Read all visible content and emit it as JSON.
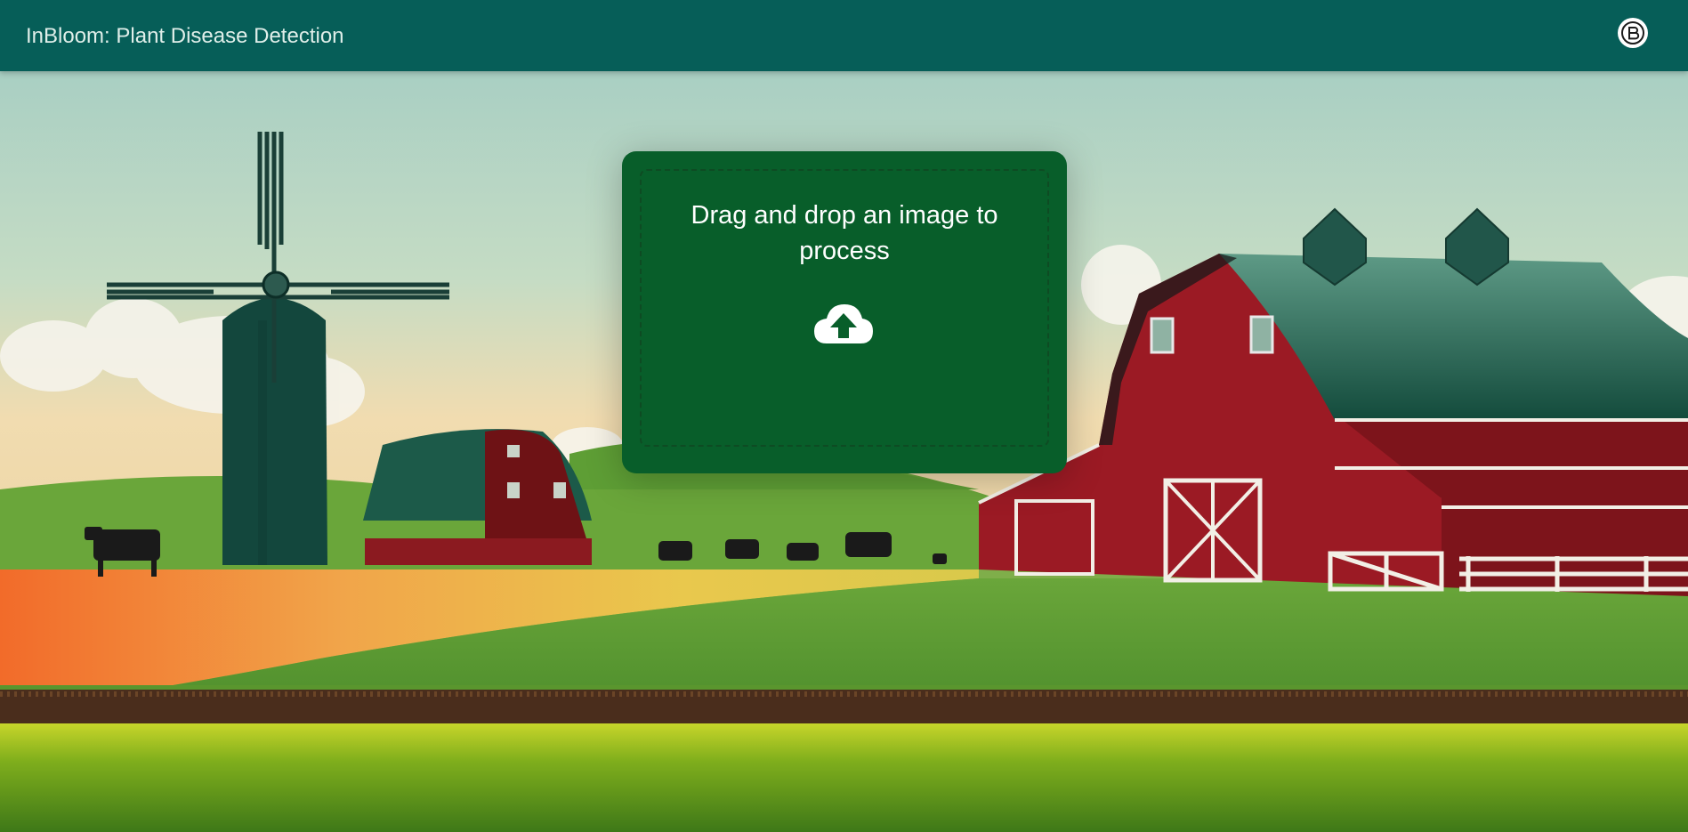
{
  "header": {
    "title": "InBloom: Plant Disease Detection",
    "profile_icon": "profile-icon"
  },
  "upload": {
    "prompt": "Drag and drop an image to process",
    "icon": "cloud-upload-icon"
  },
  "colors": {
    "header_bg": "#065e58",
    "card_bg": "#085e2a",
    "barn_red": "#9b1a24",
    "roof_green": "#1f6a55"
  }
}
